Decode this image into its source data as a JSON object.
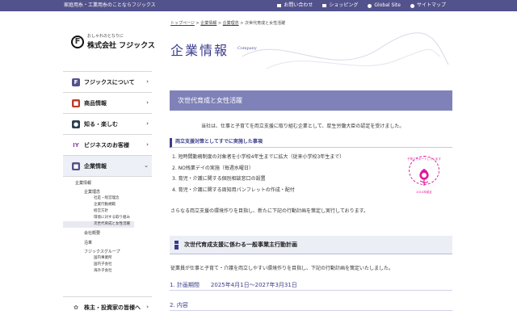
{
  "topbar": {
    "tagline": "家庭用糸・工業用糸のことならフジックス",
    "links": [
      {
        "label": "お問い合わせ",
        "icon": "mail-icon"
      },
      {
        "label": "ショッピング",
        "icon": "cart-icon"
      },
      {
        "label": "Global Site",
        "icon": "globe-icon"
      },
      {
        "label": "サイトマップ",
        "icon": "sitemap-icon"
      }
    ]
  },
  "logo": {
    "tagline": "おしゃれのとなりに",
    "name": "株式会社 フジックス"
  },
  "sidebar": {
    "items": [
      {
        "label": "フジックスについて",
        "icon": "F",
        "color": "#52528c"
      },
      {
        "label": "商品情報",
        "icon": "■",
        "color": "#c0392b"
      },
      {
        "label": "知る・楽しむ",
        "icon": "●",
        "color": "#2c3e50"
      },
      {
        "label": "ビジネスのお客様",
        "icon": "IY",
        "color": "#8e44ad"
      },
      {
        "label": "企業情報",
        "icon": "■",
        "color": "#52528c"
      }
    ],
    "submenu": {
      "title": "企業情報",
      "rinen": "企業理念",
      "rinen_children": [
        "社是・経営理念",
        "企業行動規範",
        "経営方針",
        "環境に対する取り組み",
        "次世代育成と女性活躍"
      ],
      "gaiyo": "会社概要",
      "enkaku": "沿革",
      "group": "フジックスグループ",
      "group_children": [
        "国内事業所",
        "国内子会社",
        "海外子会社"
      ]
    },
    "last_item": {
      "label": "株主・投資家の皆様へ",
      "icon": "✿",
      "color": "#7a7a7a"
    }
  },
  "breadcrumb": {
    "home": "トップページ",
    "info": "企業情報",
    "rinen": "企業理念",
    "current": "次世代育成と女性活躍"
  },
  "page": {
    "title": "企業情報",
    "subtitle": "Company",
    "banner": "次世代育成と女性活躍",
    "intro": "当社は、仕事と子育てを両立支援に取り組む企業として、厚生労働大臣の認定を受けました。",
    "section_title": "両立支援対策としてすでに実施した事項",
    "list": [
      "1. 短時間勤務制度の対象者を小学校4年生までに拡大（従来小学校3年生まで）",
      "2. NO残業デイの実施（毎週水曜日）",
      "3. 育児・介護に関する個別相談窓口の設置",
      "4. 育児・介護に関する周知用パンフレットの作成・配付"
    ],
    "summary": "さらなる両立支援の環境作りを目指し、新たに下記の行動計画を策定し実行しております。",
    "badge": {
      "arc_text": "子育てサポートしています",
      "bottom_text": "2014年認定"
    },
    "plan_box_title": "次世代育成支援に係わる一般事業主行動計画",
    "plan_text": "従業員が仕事と子育て・介護を両立しやすい環境作りを目指し、下記の行動計画を策定いたしました。",
    "period_label": "1. 計画期間",
    "period_value": "2025年4月1日〜2027年3月31日",
    "content_label": "2. 内容"
  }
}
